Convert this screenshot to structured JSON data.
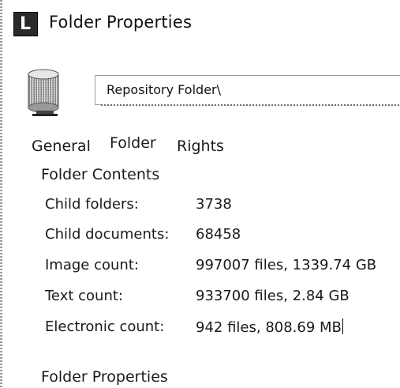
{
  "window": {
    "icon_letter": "L",
    "title": "Folder Properties"
  },
  "header": {
    "icon": "folder-drum-icon",
    "path_value": "Repository Folder\\"
  },
  "tabs": [
    {
      "label": "General",
      "selected": false
    },
    {
      "label": "Folder",
      "selected": true
    },
    {
      "label": "Rights",
      "selected": false
    }
  ],
  "folder_contents": {
    "heading": "Folder Contents",
    "rows": [
      {
        "label": "Child folders:",
        "value": "3738"
      },
      {
        "label": "Child documents:",
        "value": "68458"
      },
      {
        "label": "Image count:",
        "value": "997007 files, 1339.74 GB"
      },
      {
        "label": "Text count:",
        "value": "933700 files, 2.84 GB"
      },
      {
        "label": "Electronic count:",
        "value": "942 files, 808.69 MB"
      }
    ]
  },
  "folder_properties": {
    "heading": "Folder Properties"
  }
}
